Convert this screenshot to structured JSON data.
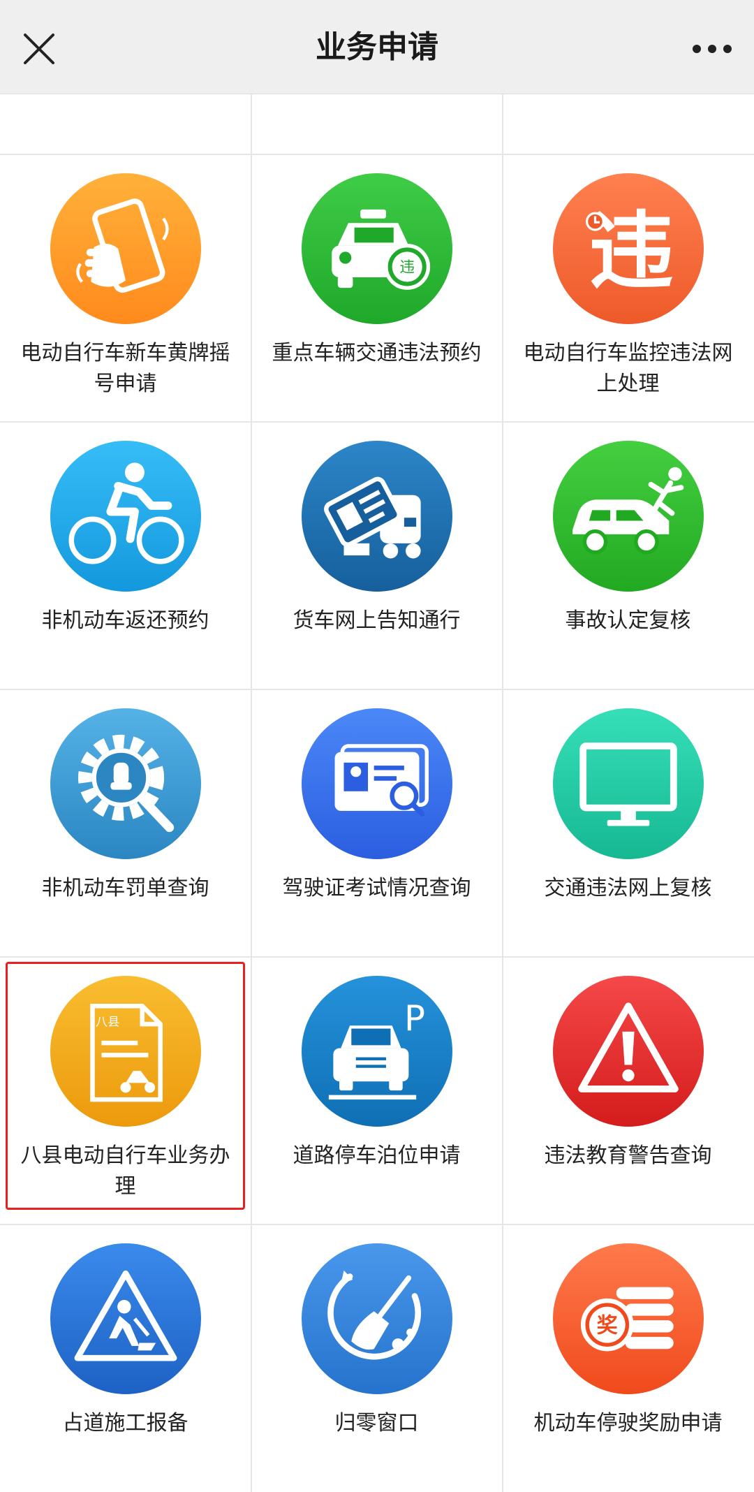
{
  "header": {
    "title": "业务申请"
  },
  "icons": [
    "close-icon",
    "more-dots-icon"
  ],
  "services": [
    {
      "label": "电动自行车新车黄牌摇号申请",
      "icon": "phone-hand-icon",
      "color_from": "#ffa928",
      "color_to": "#ff8a1c"
    },
    {
      "label": "重点车辆交通违法预约",
      "icon": "taxi-violation-icon",
      "color_from": "#34c440",
      "color_to": "#1fa82a"
    },
    {
      "label": "电动自行车监控违法网上处理",
      "icon": "violation-char-icon",
      "color_from": "#ff7a45",
      "color_to": "#ee5a2a"
    },
    {
      "label": "非机动车返还预约",
      "icon": "cyclist-icon",
      "color_from": "#2cb4f2",
      "color_to": "#1498dd"
    },
    {
      "label": "货车网上告知通行",
      "icon": "truck-card-icon",
      "color_from": "#2c86c8",
      "color_to": "#165f9c"
    },
    {
      "label": "事故认定复核",
      "icon": "car-accident-icon",
      "color_from": "#3cc83a",
      "color_to": "#22a922"
    },
    {
      "label": "非机动车罚单查询",
      "icon": "gear-search-icon",
      "color_from": "#4aa8de",
      "color_to": "#2b86c2"
    },
    {
      "label": "驾驶证考试情况查询",
      "icon": "license-search-icon",
      "color_from": "#3b7bf5",
      "color_to": "#2b5ee0"
    },
    {
      "label": "交通违法网上复核",
      "icon": "monitor-icon",
      "color_from": "#2ed8b0",
      "color_to": "#16b892"
    },
    {
      "label": "八县电动自行车业务办理",
      "icon": "document-scooter-icon",
      "color_from": "#f7b320",
      "color_to": "#ec9a0c",
      "selected": true
    },
    {
      "label": "道路停车泊位申请",
      "icon": "parking-car-icon",
      "color_from": "#1b86cf",
      "color_to": "#0f6fb4"
    },
    {
      "label": "违法教育警告查询",
      "icon": "warning-triangle-icon",
      "color_from": "#f03a3a",
      "color_to": "#d41c1c"
    },
    {
      "label": "占道施工报备",
      "icon": "road-work-icon",
      "color_from": "#2f7fe0",
      "color_to": "#1d62c4"
    },
    {
      "label": "归零窗口",
      "icon": "broom-reset-icon",
      "color_from": "#3b8ee6",
      "color_to": "#2573cc"
    },
    {
      "label": "机动车停驶奖励申请",
      "icon": "reward-coins-icon",
      "color_from": "#ff6a3a",
      "color_to": "#f04a1c"
    }
  ]
}
